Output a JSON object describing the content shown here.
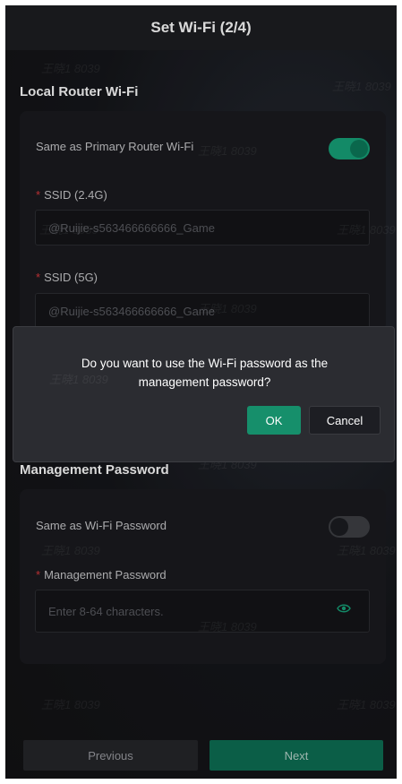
{
  "header": {
    "title": "Set Wi-Fi (2/4)"
  },
  "local_wifi": {
    "title": "Local Router Wi-Fi",
    "same_as_primary": {
      "label": "Same as Primary Router Wi-Fi",
      "on": true
    },
    "ssid_24": {
      "label": "SSID (2.4G)",
      "value": "@Ruijie-s563466666666_Game"
    },
    "ssid_5": {
      "label": "SSID (5G)",
      "value": "@Ruijie-s563466666666_Game"
    },
    "required_mark": "*"
  },
  "dialog": {
    "message": "Do you want to use the Wi-Fi password as the management password?",
    "ok_label": "OK",
    "cancel_label": "Cancel"
  },
  "management": {
    "title": "Management Password",
    "same_as_wifi": {
      "label": "Same as Wi-Fi Password",
      "on": false
    },
    "password": {
      "label": "Management Password",
      "placeholder": "Enter 8-64 characters."
    }
  },
  "footer": {
    "previous_label": "Previous",
    "next_label": "Next"
  },
  "watermark": "王晓1 8039",
  "colors": {
    "accent": "#17a37a",
    "background": "#131316",
    "dialog": "#2b2c31"
  }
}
